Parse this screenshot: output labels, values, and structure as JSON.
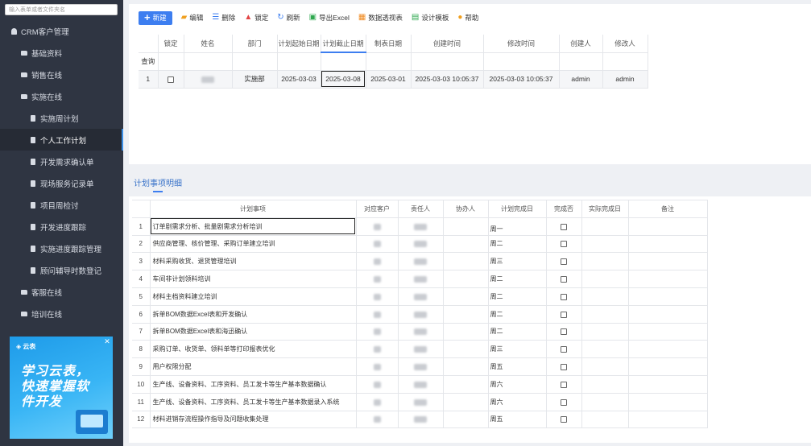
{
  "sidebar": {
    "search_placeholder": "输入表单或者文件夹名",
    "items": [
      {
        "label": "CRM客户管理",
        "level": 0,
        "icon": "user-icon",
        "name": "sidebar-item-crm"
      },
      {
        "label": "基础资料",
        "level": 1,
        "icon": "folder-icon",
        "name": "sidebar-item-basic-data"
      },
      {
        "label": "销售在线",
        "level": 1,
        "icon": "folder-icon",
        "name": "sidebar-item-sales-online"
      },
      {
        "label": "实施在线",
        "level": 1,
        "icon": "folder-icon",
        "name": "sidebar-item-implementation-online"
      },
      {
        "label": "实施周计划",
        "level": 2,
        "icon": "doc-icon",
        "name": "sidebar-item-weekly-plan"
      },
      {
        "label": "个人工作计划",
        "level": 2,
        "icon": "doc-icon",
        "name": "sidebar-item-personal-plan",
        "active": true
      },
      {
        "label": "开发需求确认单",
        "level": 2,
        "icon": "doc-icon",
        "name": "sidebar-item-dev-requirements"
      },
      {
        "label": "现场服务记录单",
        "level": 2,
        "icon": "doc-icon",
        "name": "sidebar-item-onsite-service"
      },
      {
        "label": "项目周检讨",
        "level": 2,
        "icon": "doc-icon",
        "name": "sidebar-item-project-review"
      },
      {
        "label": "开发进度跟踪",
        "level": 2,
        "icon": "doc-icon",
        "name": "sidebar-item-dev-progress"
      },
      {
        "label": "实施进度跟踪管理",
        "level": 2,
        "icon": "doc-icon",
        "name": "sidebar-item-impl-progress"
      },
      {
        "label": "顾问辅导时数登记",
        "level": 2,
        "icon": "doc-icon",
        "name": "sidebar-item-consultant-hours"
      },
      {
        "label": "客服在线",
        "level": 1,
        "icon": "folder-icon",
        "name": "sidebar-item-service-online"
      },
      {
        "label": "培训在线",
        "level": 1,
        "icon": "folder-icon",
        "name": "sidebar-item-training-online"
      }
    ],
    "ad": {
      "logo": "◈ 云表",
      "close": "✕",
      "line1": "学习云表，",
      "line2": "快速掌握软",
      "line3": "件开发"
    }
  },
  "toolbar": {
    "buttons": [
      {
        "label": "新建",
        "icon": "plus-icon",
        "glyph": "+",
        "color": "#ffffff",
        "name": "new-button",
        "primary": true
      },
      {
        "label": "编辑",
        "icon": "folder-edit-icon",
        "glyph": "▰",
        "color": "#f0a020",
        "name": "edit-button"
      },
      {
        "label": "删除",
        "icon": "delete-list-icon",
        "glyph": "☰",
        "color": "#3d7ef0",
        "name": "delete-button"
      },
      {
        "label": "锁定",
        "icon": "lock-icon",
        "glyph": "▲",
        "color": "#e24444",
        "name": "lock-button"
      },
      {
        "label": "刷新",
        "icon": "refresh-icon",
        "glyph": "↻",
        "color": "#3d7ef0",
        "name": "refresh-button"
      },
      {
        "label": "导出Excel",
        "icon": "excel-icon",
        "glyph": "▣",
        "color": "#2fa84f",
        "name": "export-excel-button"
      },
      {
        "label": "数据透视表",
        "icon": "pivot-table-icon",
        "glyph": "▦",
        "color": "#f08a20",
        "name": "pivot-table-button"
      },
      {
        "label": "设计模板",
        "icon": "design-template-icon",
        "glyph": "▤",
        "color": "#2fa84f",
        "name": "design-template-button"
      },
      {
        "label": "帮助",
        "icon": "help-icon",
        "glyph": "●",
        "color": "#f0a020",
        "name": "help-button"
      }
    ]
  },
  "main_grid": {
    "columns": [
      "",
      "锁定",
      "姓名",
      "部门",
      "计划起始日期",
      "计划截止日期",
      "制表日期",
      "创建时间",
      "修改时间",
      "创建人",
      "修改人"
    ],
    "query_label": "查询",
    "rows": [
      {
        "index": "1",
        "department": "实施部",
        "start_date": "2025-03-03",
        "end_date": "2025-03-08",
        "table_date": "2025-03-01",
        "created_at": "2025-03-03 10:05:37",
        "modified_at": "2025-03-03 10:05:37",
        "creator": "admin",
        "modifier": "admin"
      }
    ]
  },
  "detail": {
    "title": "计划事项明细",
    "columns": [
      "",
      "计划事项",
      "对应客户",
      "责任人",
      "协办人",
      "计划完成日",
      "完成否",
      "实际完成日",
      "备注"
    ],
    "rows": [
      {
        "index": "1",
        "task": "订单剧需求分析、批量剧需求分析培训",
        "day": "周一"
      },
      {
        "index": "2",
        "task": "供应商管理、核价管理、采购订单建立培训",
        "day": "周二"
      },
      {
        "index": "3",
        "task": "材料采购收货、退货管理培训",
        "day": "周三"
      },
      {
        "index": "4",
        "task": "车间非计划领料培训",
        "day": "周二"
      },
      {
        "index": "5",
        "task": "材料主档资料建立培训",
        "day": "周二"
      },
      {
        "index": "6",
        "task": "拆单BOM数据Excel表和开发确认",
        "day": "周二"
      },
      {
        "index": "7",
        "task": "拆单BOM数据Excel表和海迅确认",
        "day": "周二"
      },
      {
        "index": "8",
        "task": "采购订单、收货单、领料单等打印报表优化",
        "day": "周三"
      },
      {
        "index": "9",
        "task": "用户权限分配",
        "day": "周五"
      },
      {
        "index": "10",
        "task": "生产线、设备资料、工序资料、员工发卡等生产基本数据确认",
        "day": "周六"
      },
      {
        "index": "11",
        "task": "生产线、设备资料、工序资料、员工发卡等生产基本数据录入系统",
        "day": "周六"
      },
      {
        "index": "12",
        "task": "材料进销存流程操作指导及问题收集处理",
        "day": "周五"
      }
    ]
  }
}
